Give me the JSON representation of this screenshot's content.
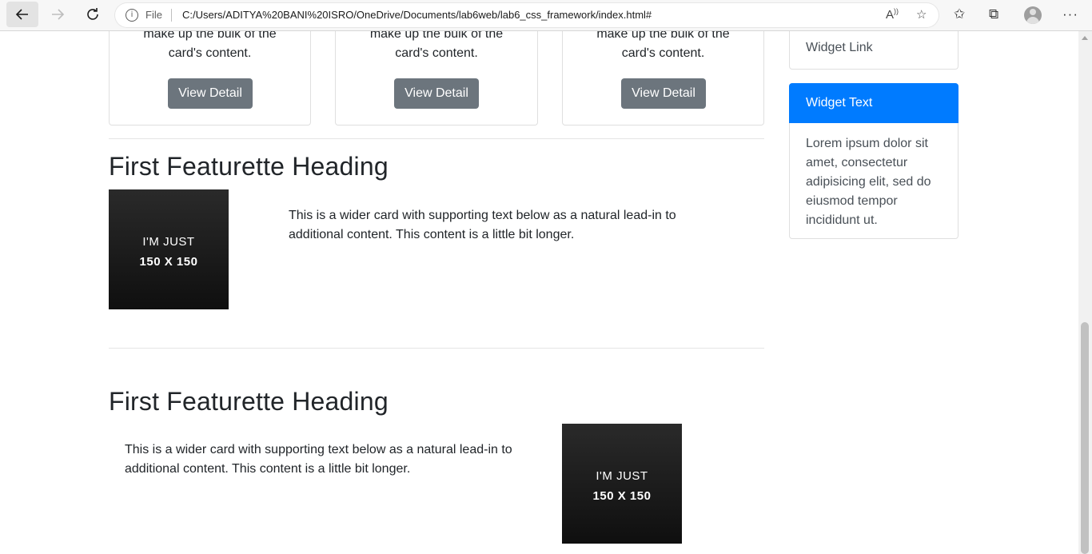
{
  "browser": {
    "scheme_label": "File",
    "url": "C:/Users/ADITYA%20BANI%20ISRO/OneDrive/Documents/lab6web/lab6_css_framework/index.html#"
  },
  "cards": [
    {
      "text_line1": "make up the bulk of the",
      "text_line2": "card's content.",
      "button_label": "View Detail"
    },
    {
      "text_line1": "make up the bulk of the",
      "text_line2": "card's content.",
      "button_label": "View Detail"
    },
    {
      "text_line1": "make up the bulk of the",
      "text_line2": "card's content.",
      "button_label": "View Detail"
    }
  ],
  "featurettes": [
    {
      "heading": "First Featurette Heading",
      "text_line1": "This is a wider card with supporting text below as a natural lead-in to",
      "text_line2": "additional content. This content is a little bit longer.",
      "image_line1": "I'M JUST",
      "image_line2": "150 X 150"
    },
    {
      "heading": "First Featurette Heading",
      "text_line1": "This is a wider card with supporting text below as a natural lead-in to",
      "text_line2": "additional content. This content is a little bit longer.",
      "image_line1": "I'M JUST",
      "image_line2": "150 X 150"
    }
  ],
  "sidebar": {
    "widget_link": "Widget Link",
    "widget_text_title": "Widget Text",
    "widget_text_lines": [
      "Lorem ipsum dolor sit",
      "amet, consectetur",
      "adipisicing elit, sed do",
      "eiusmod tempor",
      "incididunt ut."
    ]
  },
  "colors": {
    "primary": "#007bff",
    "secondary": "#6c757d"
  }
}
